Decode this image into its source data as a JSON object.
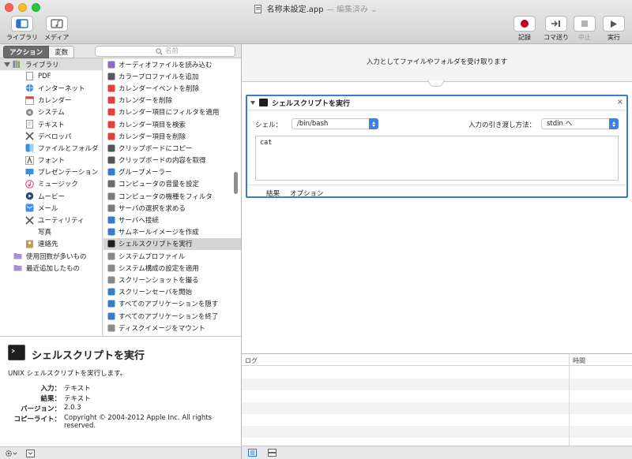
{
  "window": {
    "title": "名称未設定.app",
    "subtitle": "— 編集済み"
  },
  "toolbar": {
    "library": "ライブラリ",
    "media": "メディア",
    "record": "記録",
    "step": "コマ送り",
    "stop": "中止",
    "run": "実行"
  },
  "tabs": {
    "actions": "アクション",
    "variables": "変数"
  },
  "search": {
    "placeholder": "名前"
  },
  "library": {
    "root": "ライブラリ",
    "items": [
      "PDF",
      "インターネット",
      "カレンダー",
      "システム",
      "テキスト",
      "デベロッパ",
      "ファイルとフォルダ",
      "フォント",
      "プレゼンテーション",
      "ミュージック",
      "ムービー",
      "メール",
      "ユーティリティ",
      "写真",
      "連絡先"
    ],
    "smart": [
      "使用回数が多いもの",
      "最近追加したもの"
    ]
  },
  "actions": {
    "items": [
      "オーディオファイルを読み込む",
      "カラープロファイルを追加",
      "カレンダーイベントを削除",
      "カレンダーを削除",
      "カレンダー項目にフィルタを適用",
      "カレンダー項目を検索",
      "カレンダー項目を削除",
      "クリップボードにコピー",
      "クリップボードの内容を取得",
      "グループメーラー",
      "コンピュータの音量を設定",
      "コンピュータの機種をフィルタ",
      "サーバの選択を求める",
      "サーバへ接続",
      "サムネールイメージを作成",
      "シェルスクリプトを実行",
      "システムプロファイル",
      "システム構成の設定を適用",
      "スクリーンショットを撮る",
      "スクリーンセーバを開始",
      "すべてのアプリケーションを隠す",
      "すべてのアプリケーションを終了",
      "ディスクイメージをマウント"
    ],
    "selected_index": 15
  },
  "description": {
    "title": "シェルスクリプトを実行",
    "text": "UNIX シェルスクリプトを実行します。",
    "input_label": "入力：",
    "input_value": "テキスト",
    "result_label": "結果：",
    "result_value": "テキスト",
    "version_label": "バージョン：",
    "version_value": "2.0.3",
    "copyright_label": "コピーライト：",
    "copyright_value": "Copyright © 2004-2012 Apple Inc.  All rights reserved."
  },
  "workflow": {
    "header": "入力としてファイルやフォルダを受け取ります",
    "card": {
      "title": "シェルスクリプトを実行",
      "shell_label": "シェル：",
      "shell_value": "/bin/bash",
      "pass_label": "入力の引き渡し方法：",
      "pass_value": "stdin へ",
      "script": "cat",
      "results_tab": "結果",
      "options_tab": "オプション"
    }
  },
  "log": {
    "col_log": "ログ",
    "col_time": "時間"
  },
  "colors": {
    "accent": "#3f79d0",
    "record": "#c4001c"
  }
}
